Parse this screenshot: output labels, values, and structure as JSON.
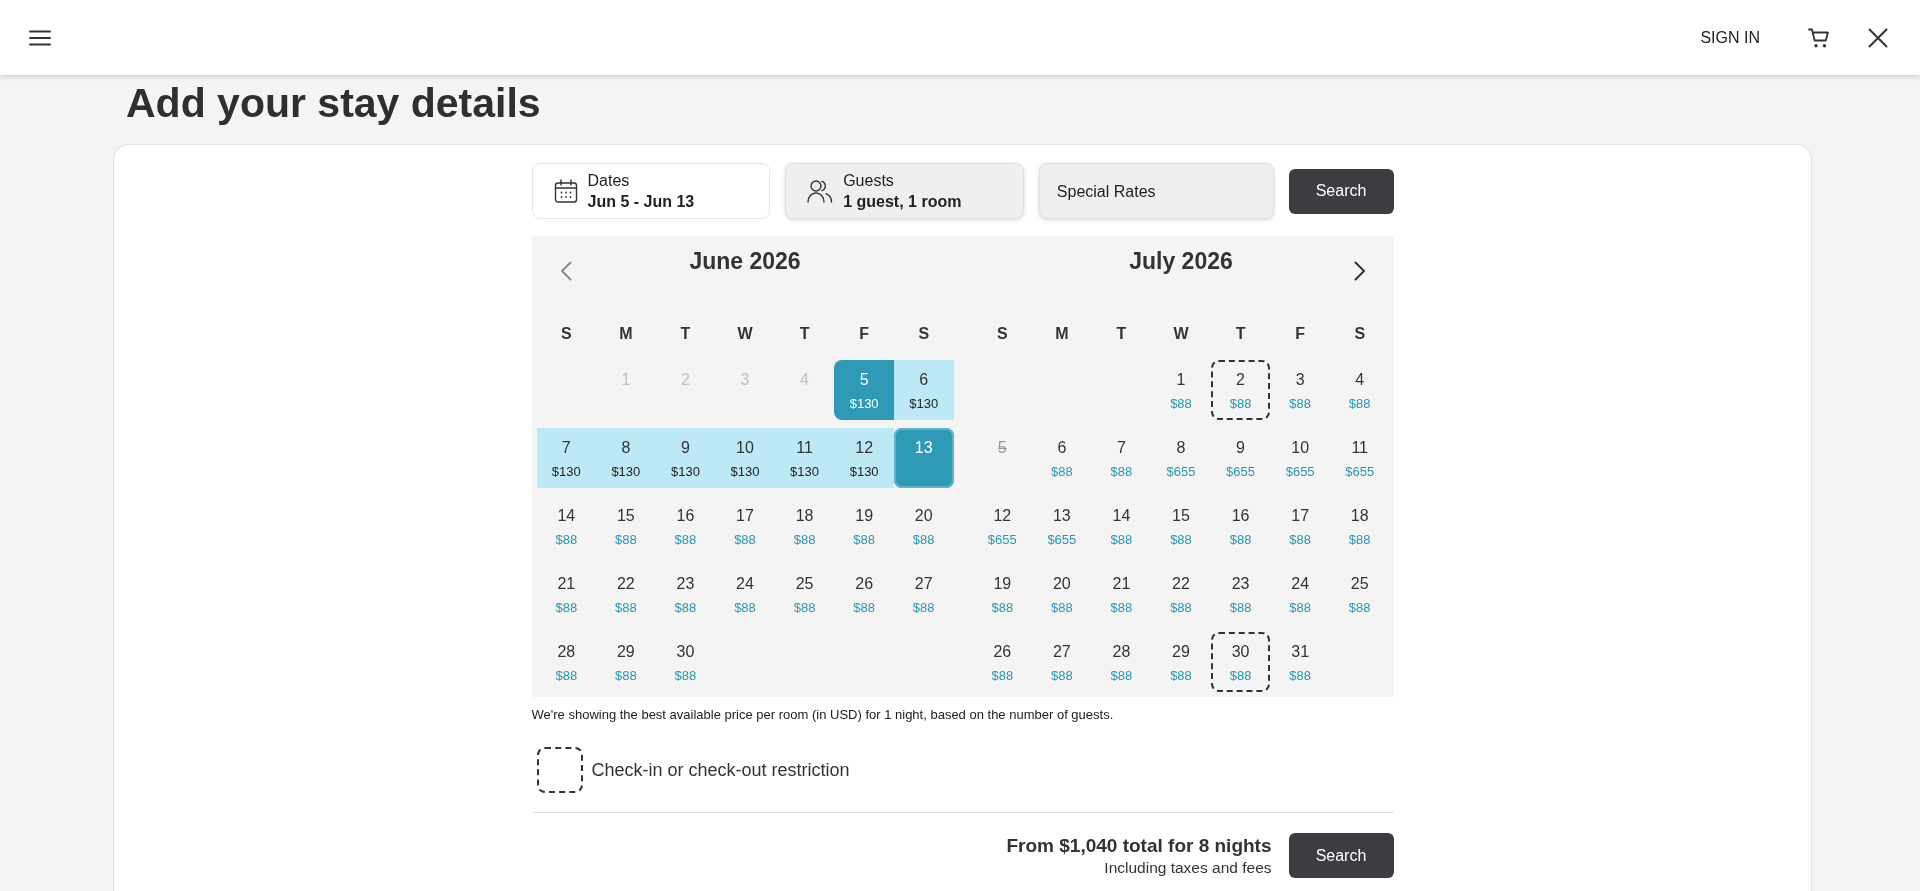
{
  "header": {
    "sign_in": "SIGN IN"
  },
  "page_title": "Add your stay details",
  "search_bar": {
    "fields": [
      {
        "kind": "dates",
        "label": "Dates",
        "value": "Jun 5 - Jun 13",
        "selected": true
      },
      {
        "kind": "guests",
        "label": "Guests",
        "value": "1 guest, 1 room",
        "selected": false
      },
      {
        "kind": "special_rates",
        "label": "Special Rates",
        "selected": false
      }
    ],
    "button": "Search"
  },
  "calendar": {
    "months": [
      {
        "title": "June 2026",
        "nav": {
          "kind": "prev",
          "disabled": true
        },
        "weekdays": [
          "S",
          "M",
          "T",
          "W",
          "T",
          "F",
          "S"
        ],
        "weeks": [
          {
            "kind": "leading",
            "days": [
              {
                "day": "1",
                "selected": false,
                "in_range": false,
                "disabled": true,
                "restricted": false,
                "crossed_out": false
              },
              {
                "day": "2",
                "selected": false,
                "in_range": false,
                "disabled": true,
                "restricted": false,
                "crossed_out": false
              },
              {
                "day": "3",
                "selected": false,
                "in_range": false,
                "disabled": true,
                "restricted": false,
                "crossed_out": false
              },
              {
                "day": "4",
                "selected": false,
                "in_range": false,
                "disabled": true,
                "restricted": false,
                "crossed_out": false
              },
              {
                "day": "5",
                "price": "$130",
                "selected": true,
                "in_range": false,
                "disabled": false,
                "restricted": false,
                "crossed_out": false
              },
              {
                "day": "6",
                "price": "$130",
                "selected": false,
                "in_range": true,
                "disabled": false,
                "restricted": false,
                "crossed_out": false
              }
            ]
          },
          {
            "kind": "regular",
            "days": [
              {
                "day": "7",
                "price": "$130",
                "selected": false,
                "in_range": true,
                "disabled": false,
                "restricted": false,
                "crossed_out": false
              },
              {
                "day": "8",
                "price": "$130",
                "selected": false,
                "in_range": true,
                "disabled": false,
                "restricted": false,
                "crossed_out": false
              },
              {
                "day": "9",
                "price": "$130",
                "selected": false,
                "in_range": true,
                "disabled": false,
                "restricted": false,
                "crossed_out": false
              },
              {
                "day": "10",
                "price": "$130",
                "selected": false,
                "in_range": true,
                "disabled": false,
                "restricted": false,
                "crossed_out": false
              },
              {
                "day": "11",
                "price": "$130",
                "selected": false,
                "in_range": true,
                "disabled": false,
                "restricted": false,
                "crossed_out": false
              },
              {
                "day": "12",
                "price": "$130",
                "selected": false,
                "in_range": true,
                "disabled": false,
                "restricted": false,
                "crossed_out": false
              },
              {
                "day": "13",
                "selected": true,
                "in_range": false,
                "disabled": false,
                "restricted": false,
                "crossed_out": false
              }
            ]
          },
          {
            "kind": "regular",
            "days": [
              {
                "day": "14",
                "price": "$88",
                "selected": false,
                "in_range": false,
                "disabled": false,
                "restricted": false,
                "crossed_out": false
              },
              {
                "day": "15",
                "price": "$88",
                "selected": false,
                "in_range": false,
                "disabled": false,
                "restricted": false,
                "crossed_out": false
              },
              {
                "day": "16",
                "price": "$88",
                "selected": false,
                "in_range": false,
                "disabled": false,
                "restricted": false,
                "crossed_out": false
              },
              {
                "day": "17",
                "price": "$88",
                "selected": false,
                "in_range": false,
                "disabled": false,
                "restricted": false,
                "crossed_out": false
              },
              {
                "day": "18",
                "price": "$88",
                "selected": false,
                "in_range": false,
                "disabled": false,
                "restricted": false,
                "crossed_out": false
              },
              {
                "day": "19",
                "price": "$88",
                "selected": false,
                "in_range": false,
                "disabled": false,
                "restricted": false,
                "crossed_out": false
              },
              {
                "day": "20",
                "price": "$88",
                "selected": false,
                "in_range": false,
                "disabled": false,
                "restricted": false,
                "crossed_out": false
              }
            ]
          },
          {
            "kind": "regular",
            "days": [
              {
                "day": "21",
                "price": "$88",
                "selected": false,
                "in_range": false,
                "disabled": false,
                "restricted": false,
                "crossed_out": false
              },
              {
                "day": "22",
                "price": "$88",
                "selected": false,
                "in_range": false,
                "disabled": false,
                "restricted": false,
                "crossed_out": false
              },
              {
                "day": "23",
                "price": "$88",
                "selected": false,
                "in_range": false,
                "disabled": false,
                "restricted": false,
                "crossed_out": false
              },
              {
                "day": "24",
                "price": "$88",
                "selected": false,
                "in_range": false,
                "disabled": false,
                "restricted": false,
                "crossed_out": false
              },
              {
                "day": "25",
                "price": "$88",
                "selected": false,
                "in_range": false,
                "disabled": false,
                "restricted": false,
                "crossed_out": false
              },
              {
                "day": "26",
                "price": "$88",
                "selected": false,
                "in_range": false,
                "disabled": false,
                "restricted": false,
                "crossed_out": false
              },
              {
                "day": "27",
                "price": "$88",
                "selected": false,
                "in_range": false,
                "disabled": false,
                "restricted": false,
                "crossed_out": false
              }
            ]
          },
          {
            "kind": "regular",
            "days": [
              {
                "day": "28",
                "price": "$88",
                "selected": false,
                "in_range": false,
                "disabled": false,
                "restricted": false,
                "crossed_out": false
              },
              {
                "day": "29",
                "price": "$88",
                "selected": false,
                "in_range": false,
                "disabled": false,
                "restricted": false,
                "crossed_out": false
              },
              {
                "day": "30",
                "price": "$88",
                "selected": false,
                "in_range": false,
                "disabled": false,
                "restricted": false,
                "crossed_out": false
              }
            ]
          }
        ]
      },
      {
        "title": "July 2026",
        "nav": {
          "kind": "next",
          "disabled": false
        },
        "weekdays": [
          "S",
          "M",
          "T",
          "W",
          "T",
          "F",
          "S"
        ],
        "weeks": [
          {
            "kind": "leading",
            "days": [
              {
                "day": "1",
                "price": "$88",
                "selected": false,
                "in_range": false,
                "disabled": false,
                "restricted": false,
                "crossed_out": false
              },
              {
                "day": "2",
                "price": "$88",
                "selected": false,
                "in_range": false,
                "disabled": false,
                "restricted": true,
                "crossed_out": false
              },
              {
                "day": "3",
                "price": "$88",
                "selected": false,
                "in_range": false,
                "disabled": false,
                "restricted": false,
                "crossed_out": false
              },
              {
                "day": "4",
                "price": "$88",
                "selected": false,
                "in_range": false,
                "disabled": false,
                "restricted": false,
                "crossed_out": false
              }
            ]
          },
          {
            "kind": "regular",
            "days": [
              {
                "day": "5",
                "selected": false,
                "in_range": false,
                "disabled": true,
                "restricted": false,
                "crossed_out": true
              },
              {
                "day": "6",
                "price": "$88",
                "selected": false,
                "in_range": false,
                "disabled": false,
                "restricted": false,
                "crossed_out": false
              },
              {
                "day": "7",
                "price": "$88",
                "selected": false,
                "in_range": false,
                "disabled": false,
                "restricted": false,
                "crossed_out": false
              },
              {
                "day": "8",
                "price": "$655",
                "selected": false,
                "in_range": false,
                "disabled": false,
                "restricted": false,
                "crossed_out": false
              },
              {
                "day": "9",
                "price": "$655",
                "selected": false,
                "in_range": false,
                "disabled": false,
                "restricted": false,
                "crossed_out": false
              },
              {
                "day": "10",
                "price": "$655",
                "selected": false,
                "in_range": false,
                "disabled": false,
                "restricted": false,
                "crossed_out": false
              },
              {
                "day": "11",
                "price": "$655",
                "selected": false,
                "in_range": false,
                "disabled": false,
                "restricted": false,
                "crossed_out": false
              }
            ]
          },
          {
            "kind": "regular",
            "days": [
              {
                "day": "12",
                "price": "$655",
                "selected": false,
                "in_range": false,
                "disabled": false,
                "restricted": false,
                "crossed_out": false
              },
              {
                "day": "13",
                "price": "$655",
                "selected": false,
                "in_range": false,
                "disabled": false,
                "restricted": false,
                "crossed_out": false
              },
              {
                "day": "14",
                "price": "$88",
                "selected": false,
                "in_range": false,
                "disabled": false,
                "restricted": false,
                "crossed_out": false
              },
              {
                "day": "15",
                "price": "$88",
                "selected": false,
                "in_range": false,
                "disabled": false,
                "restricted": false,
                "crossed_out": false
              },
              {
                "day": "16",
                "price": "$88",
                "selected": false,
                "in_range": false,
                "disabled": false,
                "restricted": false,
                "crossed_out": false
              },
              {
                "day": "17",
                "price": "$88",
                "selected": false,
                "in_range": false,
                "disabled": false,
                "restricted": false,
                "crossed_out": false
              },
              {
                "day": "18",
                "price": "$88",
                "selected": false,
                "in_range": false,
                "disabled": false,
                "restricted": false,
                "crossed_out": false
              }
            ]
          },
          {
            "kind": "regular",
            "days": [
              {
                "day": "19",
                "price": "$88",
                "selected": false,
                "in_range": false,
                "disabled": false,
                "restricted": false,
                "crossed_out": false
              },
              {
                "day": "20",
                "price": "$88",
                "selected": false,
                "in_range": false,
                "disabled": false,
                "restricted": false,
                "crossed_out": false
              },
              {
                "day": "21",
                "price": "$88",
                "selected": false,
                "in_range": false,
                "disabled": false,
                "restricted": false,
                "crossed_out": false
              },
              {
                "day": "22",
                "price": "$88",
                "selected": false,
                "in_range": false,
                "disabled": false,
                "restricted": false,
                "crossed_out": false
              },
              {
                "day": "23",
                "price": "$88",
                "selected": false,
                "in_range": false,
                "disabled": false,
                "restricted": false,
                "crossed_out": false
              },
              {
                "day": "24",
                "price": "$88",
                "selected": false,
                "in_range": false,
                "disabled": false,
                "restricted": false,
                "crossed_out": false
              },
              {
                "day": "25",
                "price": "$88",
                "selected": false,
                "in_range": false,
                "disabled": false,
                "restricted": false,
                "crossed_out": false
              }
            ]
          },
          {
            "kind": "regular",
            "days": [
              {
                "day": "26",
                "price": "$88",
                "selected": false,
                "in_range": false,
                "disabled": false,
                "restricted": false,
                "crossed_out": false
              },
              {
                "day": "27",
                "price": "$88",
                "selected": false,
                "in_range": false,
                "disabled": false,
                "restricted": false,
                "crossed_out": false
              },
              {
                "day": "28",
                "price": "$88",
                "selected": false,
                "in_range": false,
                "disabled": false,
                "restricted": false,
                "crossed_out": false
              },
              {
                "day": "29",
                "price": "$88",
                "selected": false,
                "in_range": false,
                "disabled": false,
                "restricted": false,
                "crossed_out": false
              },
              {
                "day": "30",
                "price": "$88",
                "selected": false,
                "in_range": false,
                "disabled": false,
                "restricted": true,
                "crossed_out": false
              },
              {
                "day": "31",
                "price": "$88",
                "selected": false,
                "in_range": false,
                "disabled": false,
                "restricted": false,
                "crossed_out": false
              }
            ]
          }
        ]
      }
    ]
  },
  "price_note": "We're showing the best available price per room (in USD) for 1 night, based on the number of guests.",
  "legend": {
    "kind": "restricted",
    "label": "Check-in or check-out restriction"
  },
  "summary": {
    "total": "From $1,040 total for 8 nights",
    "note": "Including taxes and fees",
    "button": "Search"
  }
}
